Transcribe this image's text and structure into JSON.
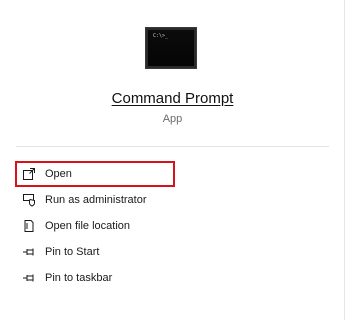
{
  "app": {
    "name": "Command Prompt",
    "type": "App",
    "icon": "command-prompt-icon",
    "icon_prompt_text": "C:\\>_"
  },
  "menu": {
    "items": [
      {
        "label": "Open",
        "icon": "open-window-icon",
        "selected": true
      },
      {
        "label": "Run as administrator",
        "icon": "shield-icon",
        "selected": false
      },
      {
        "label": "Open file location",
        "icon": "file-location-icon",
        "selected": false
      },
      {
        "label": "Pin to Start",
        "icon": "pin-icon",
        "selected": false
      },
      {
        "label": "Pin to taskbar",
        "icon": "pin-icon",
        "selected": false
      }
    ]
  },
  "colors": {
    "highlight_border": "#d6121a",
    "text": "#1a1a1a",
    "secondary_text": "#6b6b6b"
  }
}
